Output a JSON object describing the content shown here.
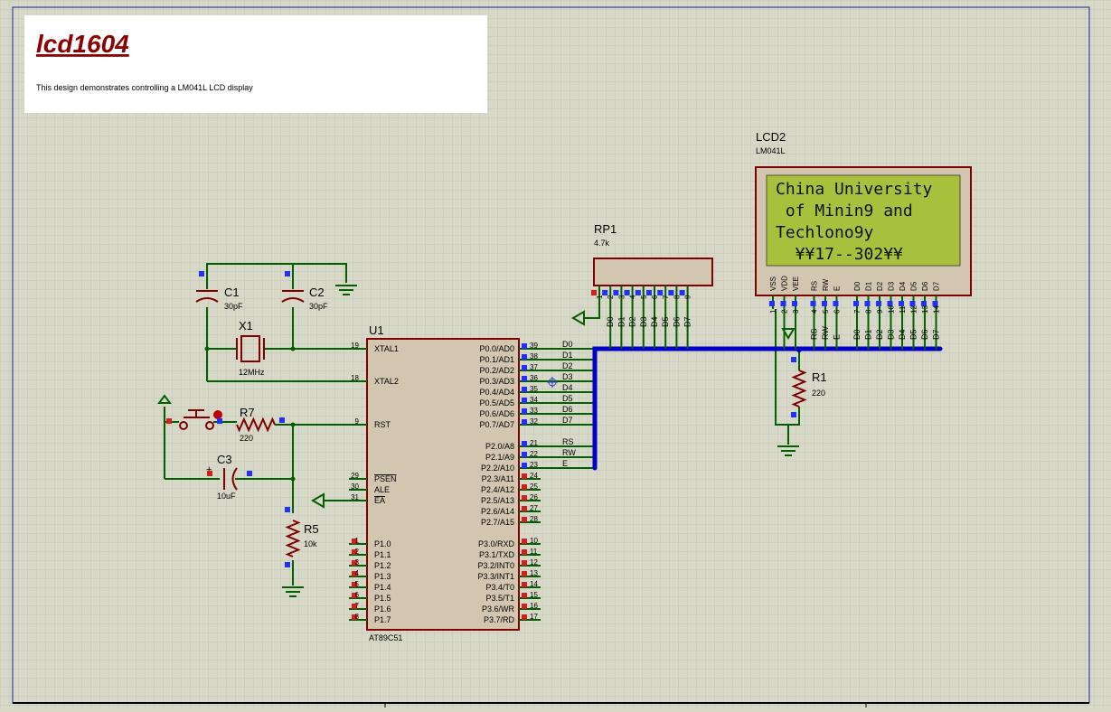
{
  "header": {
    "title": "lcd1604",
    "description": "This design demonstrates controlling a LM041L LCD display"
  },
  "colors": {
    "grid_bg": "#d8d8c8",
    "wire": "#006000",
    "component": "#800000",
    "chip_fill": "#d2c6b0",
    "bus": "#0000c8",
    "lcd_screen": "#a8c03c",
    "title_color": "#8b0000"
  },
  "lcd": {
    "ref": "LCD2",
    "model": "LM041L",
    "lines": [
      "China University",
      " of Minin9 and",
      "Techlono9y",
      "  ¥¥17--302¥¥"
    ],
    "pin_labels": [
      "VSS",
      "VDD",
      "VEE",
      "RS",
      "RW",
      "E",
      "D0",
      "D1",
      "D2",
      "D3",
      "D4",
      "D5",
      "D6",
      "D7"
    ],
    "pin_numbers": [
      "1",
      "2",
      "3",
      "4",
      "5",
      "6",
      "7",
      "8",
      "9",
      "10",
      "11",
      "12",
      "13",
      "14"
    ],
    "bus_labels": [
      "RS",
      "RW",
      "E",
      "D0",
      "D1",
      "D2",
      "D3",
      "D4",
      "D5",
      "D6",
      "D7"
    ]
  },
  "rp1": {
    "ref": "RP1",
    "value": "4.7k",
    "pin_numbers": [
      "1",
      "2",
      "3",
      "4",
      "5",
      "6",
      "7",
      "8",
      "9"
    ],
    "net_labels": [
      "D0",
      "D1",
      "D2",
      "D3",
      "D4",
      "D5",
      "D6",
      "D7"
    ]
  },
  "mcu": {
    "ref": "U1",
    "model": "AT89C51",
    "left_pins": [
      {
        "num": "19",
        "name": "XTAL1"
      },
      {
        "num": "18",
        "name": "XTAL2"
      },
      {
        "num": "9",
        "name": "RST"
      },
      {
        "num": "29",
        "name": "PSEN"
      },
      {
        "num": "30",
        "name": "ALE"
      },
      {
        "num": "31",
        "name": "EA"
      },
      {
        "num": "1",
        "name": "P1.0"
      },
      {
        "num": "2",
        "name": "P1.1"
      },
      {
        "num": "3",
        "name": "P1.2"
      },
      {
        "num": "4",
        "name": "P1.3"
      },
      {
        "num": "5",
        "name": "P1.4"
      },
      {
        "num": "6",
        "name": "P1.5"
      },
      {
        "num": "7",
        "name": "P1.6"
      },
      {
        "num": "8",
        "name": "P1.7"
      }
    ],
    "right_pins": [
      {
        "num": "39",
        "name": "P0.0/AD0",
        "net": "D0"
      },
      {
        "num": "38",
        "name": "P0.1/AD1",
        "net": "D1"
      },
      {
        "num": "37",
        "name": "P0.2/AD2",
        "net": "D2"
      },
      {
        "num": "36",
        "name": "P0.3/AD3",
        "net": "D3"
      },
      {
        "num": "35",
        "name": "P0.4/AD4",
        "net": "D4"
      },
      {
        "num": "34",
        "name": "P0.5/AD5",
        "net": "D5"
      },
      {
        "num": "33",
        "name": "P0.6/AD6",
        "net": "D6"
      },
      {
        "num": "32",
        "name": "P0.7/AD7",
        "net": "D7"
      },
      {
        "num": "21",
        "name": "P2.0/A8",
        "net": "RS"
      },
      {
        "num": "22",
        "name": "P2.1/A9",
        "net": "RW"
      },
      {
        "num": "23",
        "name": "P2.2/A10",
        "net": "E"
      },
      {
        "num": "24",
        "name": "P2.3/A11",
        "net": ""
      },
      {
        "num": "25",
        "name": "P2.4/A12",
        "net": ""
      },
      {
        "num": "26",
        "name": "P2.5/A13",
        "net": ""
      },
      {
        "num": "27",
        "name": "P2.6/A14",
        "net": ""
      },
      {
        "num": "28",
        "name": "P2.7/A15",
        "net": ""
      },
      {
        "num": "10",
        "name": "P3.0/RXD",
        "net": ""
      },
      {
        "num": "11",
        "name": "P3.1/TXD",
        "net": ""
      },
      {
        "num": "12",
        "name": "P3.2/INT0",
        "net": ""
      },
      {
        "num": "13",
        "name": "P3.3/INT1",
        "net": ""
      },
      {
        "num": "14",
        "name": "P3.4/T0",
        "net": ""
      },
      {
        "num": "15",
        "name": "P3.5/T1",
        "net": ""
      },
      {
        "num": "16",
        "name": "P3.6/WR",
        "net": ""
      },
      {
        "num": "17",
        "name": "P3.7/RD",
        "net": ""
      }
    ]
  },
  "parts": {
    "c1": {
      "ref": "C1",
      "value": "30pF"
    },
    "c2": {
      "ref": "C2",
      "value": "30pF"
    },
    "x1": {
      "ref": "X1",
      "value": "12MHz"
    },
    "r7": {
      "ref": "R7",
      "value": "220"
    },
    "c3": {
      "ref": "C3",
      "value": "10uF"
    },
    "r5": {
      "ref": "R5",
      "value": "10k"
    },
    "r1": {
      "ref": "R1",
      "value": "220"
    }
  }
}
